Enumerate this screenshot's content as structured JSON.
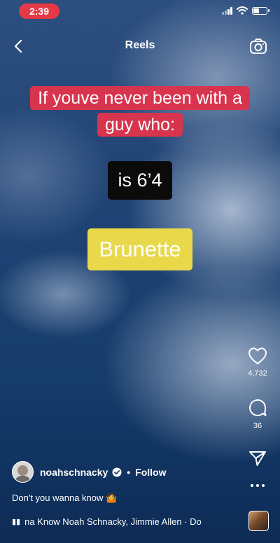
{
  "status_bar": {
    "time": "2:39"
  },
  "header": {
    "title": "Reels"
  },
  "captions": {
    "red_line1": "If youve never been with a",
    "red_line2": "guy who:",
    "black": "is 6’4",
    "yellow": "Brunette"
  },
  "actions": {
    "likes": "4,732",
    "comments": "36"
  },
  "author": {
    "username": "noahschnacky",
    "separator": "•",
    "follow_label": "Follow"
  },
  "post": {
    "caption": "Don't you wanna know 🤷"
  },
  "music": {
    "text": "na Know   Noah Schnacky, Jimmie Allen · Do"
  },
  "colors": {
    "red_caption": "#d8344e",
    "yellow_caption": "#e8d84a",
    "time_pill": "#e53946"
  },
  "icons": [
    "chevron-left-icon",
    "camera-icon",
    "heart-icon",
    "comment-icon",
    "send-icon",
    "more-icon",
    "verified-icon",
    "music-bars-icon"
  ]
}
